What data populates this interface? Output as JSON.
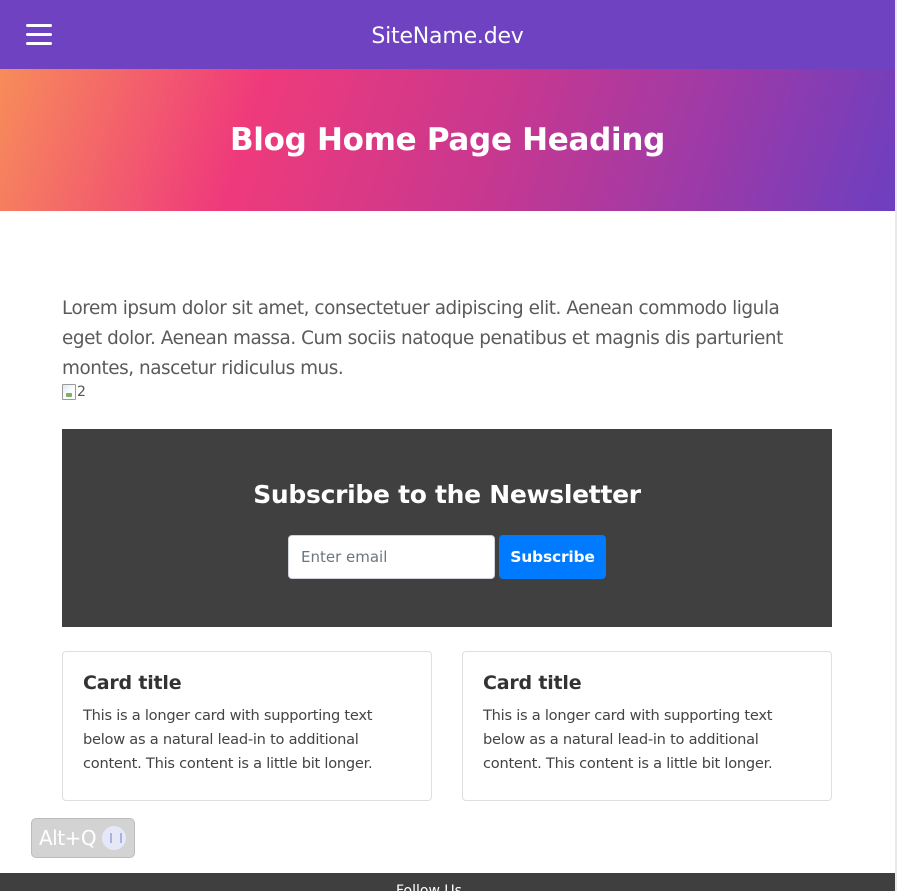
{
  "navbar": {
    "brand": "SiteName.dev",
    "menu_icon": "hamburger-menu-icon",
    "background": "#6f42c1"
  },
  "hero": {
    "heading": "Blog Home Page Heading",
    "gradient_colors": [
      "#f78c5a",
      "#ef3a7b",
      "#6c3fc0"
    ]
  },
  "main": {
    "intro": "Lorem ipsum dolor sit amet, consectetuer adipiscing elit. Aenean commodo ligula eget dolor. Aenean massa. Cum sociis natoque penatibus et magnis dis parturient montes, nascetur ridiculus mus.",
    "image_alt": "2"
  },
  "newsletter": {
    "heading": "Subscribe to the Newsletter",
    "email_placeholder": "Enter email",
    "email_value": "",
    "button_label": "Subscribe",
    "background": "#404040",
    "button_color": "#007bff"
  },
  "cards": [
    {
      "title": "Card title",
      "text": "This is a longer card with supporting text below as a natural lead-in to additional content. This content is a little bit longer."
    },
    {
      "title": "Card title",
      "text": "This is a longer card with supporting text below as a natural lead-in to additional content. This content is a little bit longer."
    }
  ],
  "widget": {
    "label": "Alt+Q",
    "icon": "voice-assistant-icon"
  },
  "footer": {
    "text": "Follow Us"
  }
}
